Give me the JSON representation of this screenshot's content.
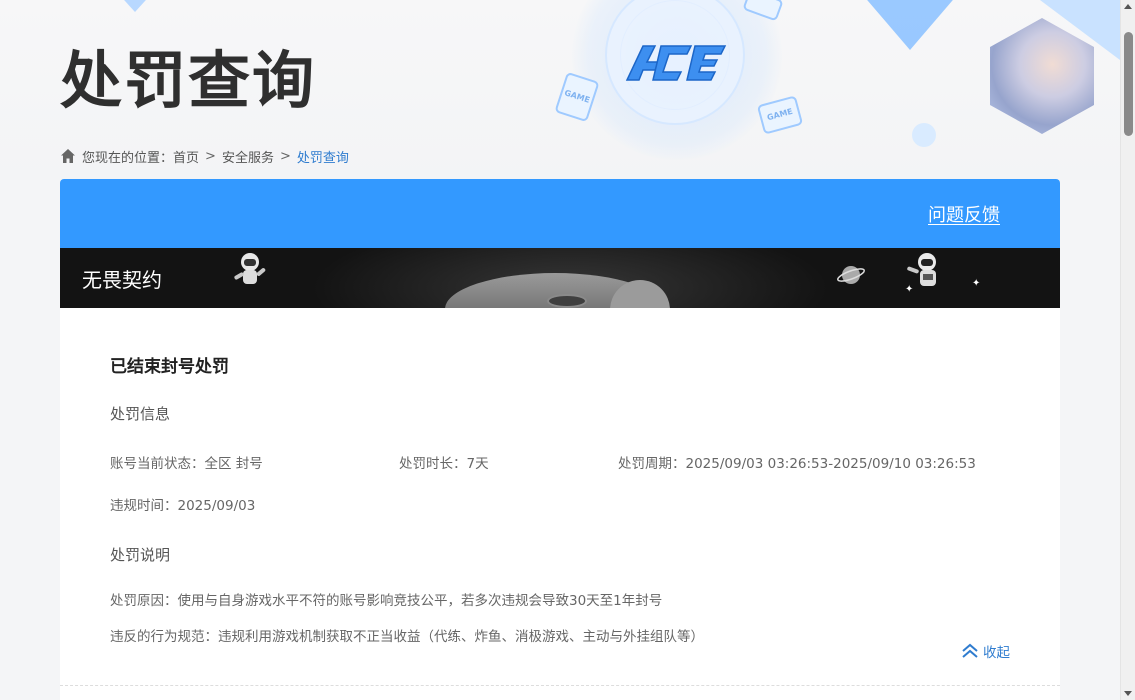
{
  "page": {
    "title": "处罚查询",
    "brand_logo_text": "ACE",
    "game_tag": "GAME"
  },
  "breadcrumb": {
    "prefix": "您现在的位置：",
    "items": [
      "首页",
      "安全服务",
      "处罚查询"
    ],
    "separator": ">"
  },
  "card": {
    "feedback_link": "问题反馈",
    "banner_title": "无畏契约",
    "section_title": "已结束封号处罚",
    "info_heading": "处罚信息",
    "status_label": "账号当前状态：",
    "status_value": "全区 封号",
    "duration_label": "处罚时长：",
    "duration_value": "7天",
    "period_label": "处罚周期：",
    "period_value": "2025/09/03 03:26:53-2025/09/10 03:26:53",
    "violation_time_label": "违规时间：",
    "violation_time_value": "2025/09/03",
    "desc_heading": "处罚说明",
    "reason_label": "处罚原因：",
    "reason_value": "使用与自身游戏水平不符的账号影响竞技公平，若多次违规会导致30天至1年封号",
    "rule_label": "违反的行为规范：",
    "rule_value": "违规利用游戏机制获取不正当收益（代练、炸鱼、消极游戏、主动与外挂组队等）",
    "collapse_label": "收起"
  },
  "colors": {
    "accent": "#3399ff",
    "link": "#2f7ccf",
    "banner_bg": "#131313"
  }
}
